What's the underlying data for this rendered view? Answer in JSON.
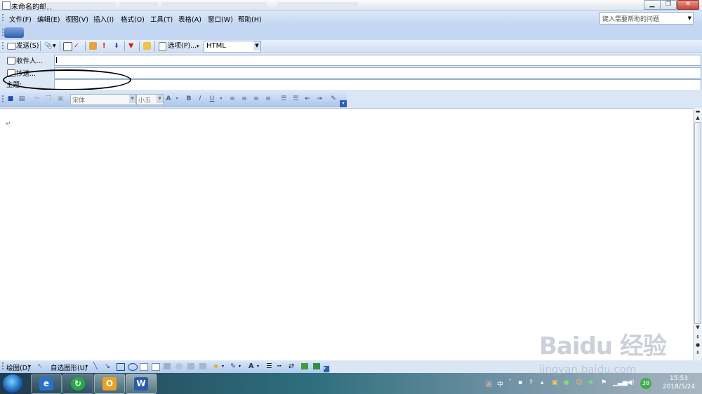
{
  "window": {
    "title": "未命名的邮件",
    "minimize_icon": "minimize-icon",
    "restore_icon": "restore-icon",
    "close_icon": "close-icon"
  },
  "menubar": {
    "items": [
      "文件(F)",
      "编辑(E)",
      "视图(V)",
      "插入(I)",
      "格式(O)",
      "工具(T)",
      "表格(A)",
      "窗口(W)",
      "帮助(H)"
    ],
    "help_search_placeholder": "键入需要帮助的问题"
  },
  "standard_toolbar": {
    "send_label": "发送(S)",
    "options_label": "选项(P)...",
    "format_value": "HTML"
  },
  "header_fields": {
    "to_label": "收件人...",
    "cc_label": "抄送...",
    "subject_label": "主题:",
    "to_value": "",
    "cc_value": "",
    "subject_value": ""
  },
  "format_toolbar": {
    "font_value": "宋体",
    "size_value": "小五"
  },
  "document": {
    "paragraph_mark": "↵"
  },
  "drawing_toolbar": {
    "draw_label": "绘图(D)",
    "autoshapes_label": "自选图形(U)"
  },
  "taskbar": {
    "time": "15:53",
    "date": "2018/5/24",
    "ime_label": "中",
    "badge_count": "38"
  },
  "watermark": {
    "logo": "Baidu 经验",
    "url": "jingyan.baidu.com"
  },
  "colors": {
    "menubar": "#c2d6f1",
    "toolbar": "#cfdff4",
    "header": "#dde8f6",
    "annotation": "#000000"
  }
}
